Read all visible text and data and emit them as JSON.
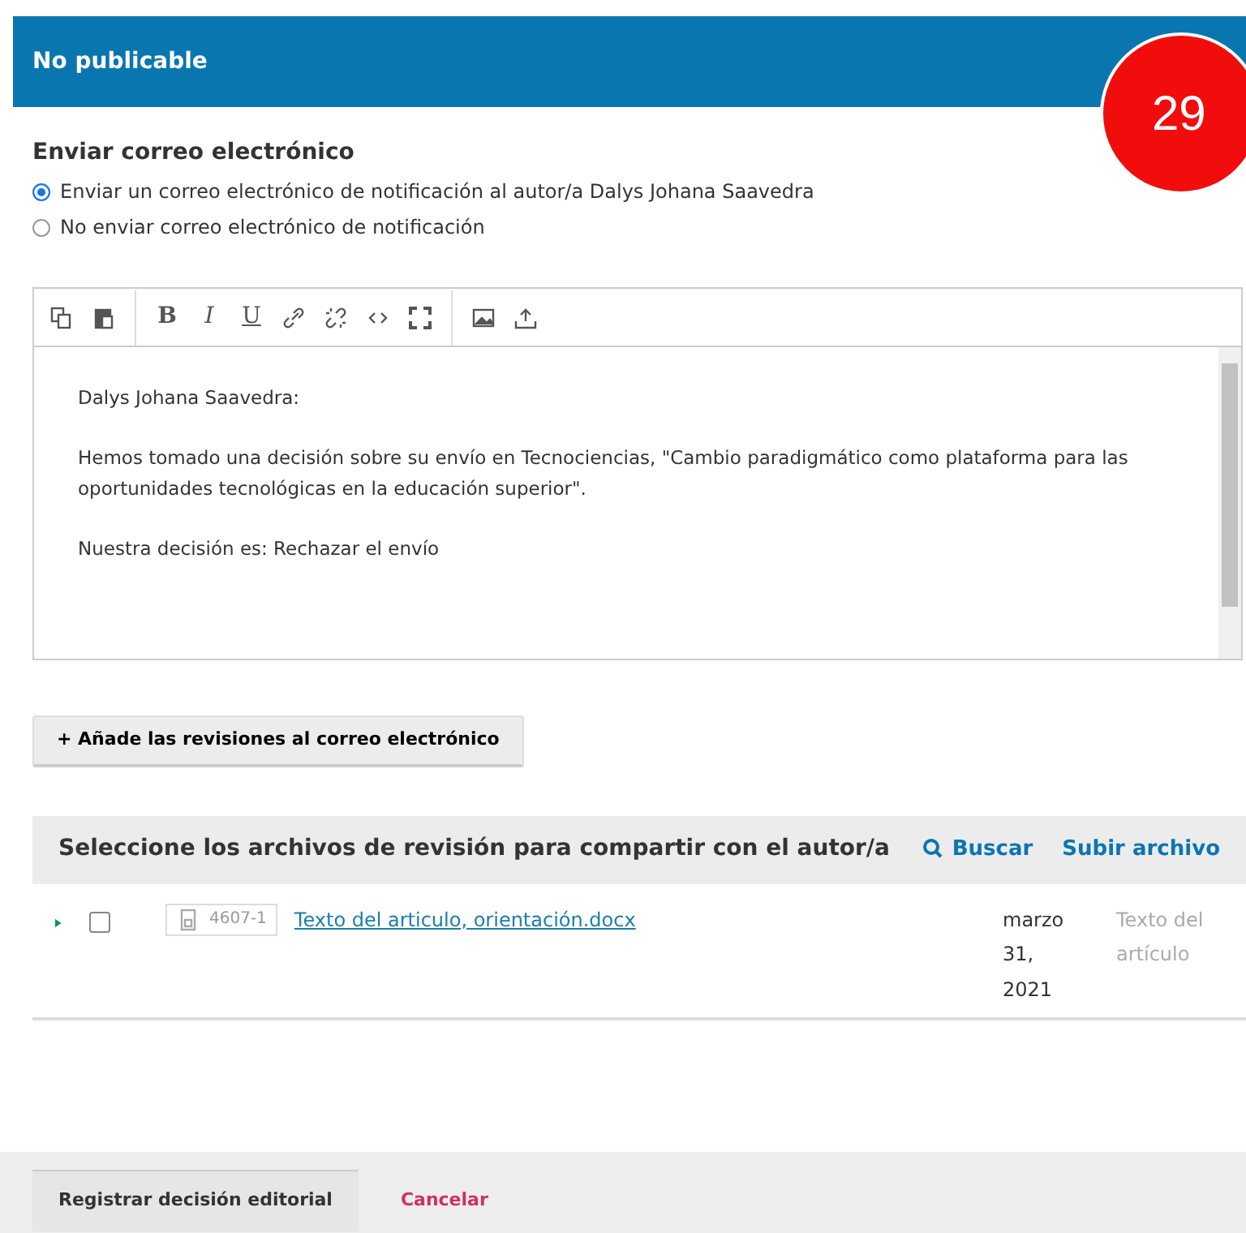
{
  "header": {
    "title": "No publicable"
  },
  "badge": {
    "text": "29"
  },
  "email": {
    "title": "Enviar correo electrónico",
    "options": [
      {
        "label": "Enviar un correo electrónico de notificación al autor/a Dalys Johana Saavedra",
        "selected": true
      },
      {
        "label": "No enviar correo electrónico de notificación",
        "selected": false
      }
    ]
  },
  "editor": {
    "toolbar": [
      {
        "kind": "copy"
      },
      {
        "kind": "paste"
      },
      {
        "kind": "sep"
      },
      {
        "kind": "bold",
        "label": "B"
      },
      {
        "kind": "italic",
        "label": "I"
      },
      {
        "kind": "underline",
        "label": "U"
      },
      {
        "kind": "link"
      },
      {
        "kind": "unlink"
      },
      {
        "kind": "code"
      },
      {
        "kind": "fullscreen"
      },
      {
        "kind": "sep"
      },
      {
        "kind": "image"
      },
      {
        "kind": "upload"
      }
    ],
    "paragraphs": [
      "Dalys Johana Saavedra:",
      "Hemos tomado una decisión sobre su envío en Tecnociencias, \"Cambio paradigmático como plataforma para las oportunidades tecnológicas en la educación superior\".",
      "Nuestra decisión es: Rechazar el envío"
    ]
  },
  "add_revisions_button": {
    "icon": "+",
    "label": "Añade las revisiones al correo electrónico"
  },
  "files": {
    "title": "Seleccione los archivos de revisión para compartir con el autor/a",
    "search": "Buscar",
    "upload": "Subir archivo",
    "rows": [
      {
        "checked": false,
        "id": "4607-1",
        "name": "Texto del articulo, orientación.docx",
        "date": "marzo 31, 2021",
        "type": "Texto del artículo"
      }
    ]
  },
  "footer": {
    "submit": "Registrar decisión editorial",
    "cancel": "Cancelar"
  }
}
